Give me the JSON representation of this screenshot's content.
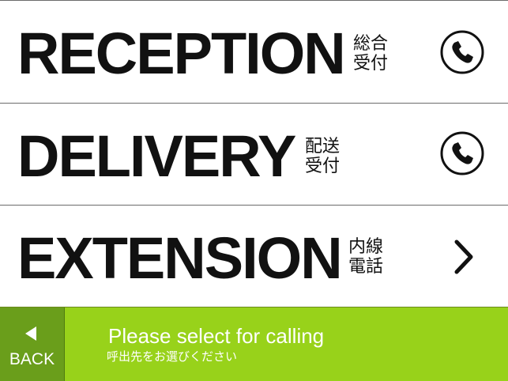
{
  "menu": {
    "items": [
      {
        "label": "RECEPTION",
        "sublabel": "総合受付",
        "icon": "phone-icon"
      },
      {
        "label": "DELIVERY",
        "sublabel": "配送受付",
        "icon": "phone-icon"
      },
      {
        "label": "EXTENSION",
        "sublabel": "内線電話",
        "icon": "chevron-right-icon"
      }
    ]
  },
  "footer": {
    "back_label": "BACK",
    "back_icon": "triangle-left-icon",
    "prompt": "Please select for calling",
    "prompt_jp": "呼出先をお選びください"
  },
  "colors": {
    "bar_green": "#98d21a",
    "back_green": "#6a9e1b",
    "text": "#111111"
  }
}
